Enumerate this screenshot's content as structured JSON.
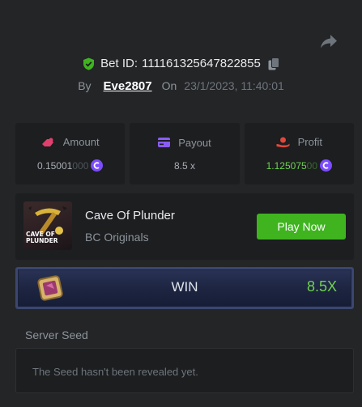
{
  "header": {
    "share_icon": "share-arrow-icon",
    "verified_icon": "shield-check-icon",
    "verified_color": "#3fb41f",
    "bet_id_label": "Bet ID:",
    "bet_id": "111161325647822855",
    "copy_icon": "copy-icon",
    "by_label": "By",
    "username": "Eve2807",
    "on_label": "On",
    "timestamp": "23/1/2023, 11:40:01"
  },
  "stats": {
    "amount": {
      "label": "Amount",
      "icon": "coin-bag-icon",
      "value_main": "0.15001",
      "value_dim": "000",
      "currency_icon": "bc-coin-icon"
    },
    "payout": {
      "label": "Payout",
      "icon": "card-icon",
      "value": "8.5 x"
    },
    "profit": {
      "label": "Profit",
      "icon": "hand-coin-icon",
      "value_main": "1.125075",
      "value_dim": "00",
      "currency_icon": "bc-coin-icon"
    }
  },
  "game": {
    "title": "Cave Of Plunder",
    "provider": "BC Originals",
    "thumb_text": "CAVE OF PLUNDER",
    "play_label": "Play Now",
    "play_color": "#3fb41f"
  },
  "result": {
    "icon": "gem-tile-icon",
    "label": "WIN",
    "multiplier": "8.5X",
    "multiplier_color": "#6fd34e"
  },
  "seed": {
    "label": "Server Seed",
    "message": "The Seed hasn't been revealed yet."
  },
  "colors": {
    "background": "#232527",
    "card": "#1c1e20",
    "amount_icon": "#e0406b",
    "payout_icon": "#8a5cf6",
    "profit_icon": "#e0483c",
    "coin": "#7c4dff"
  }
}
